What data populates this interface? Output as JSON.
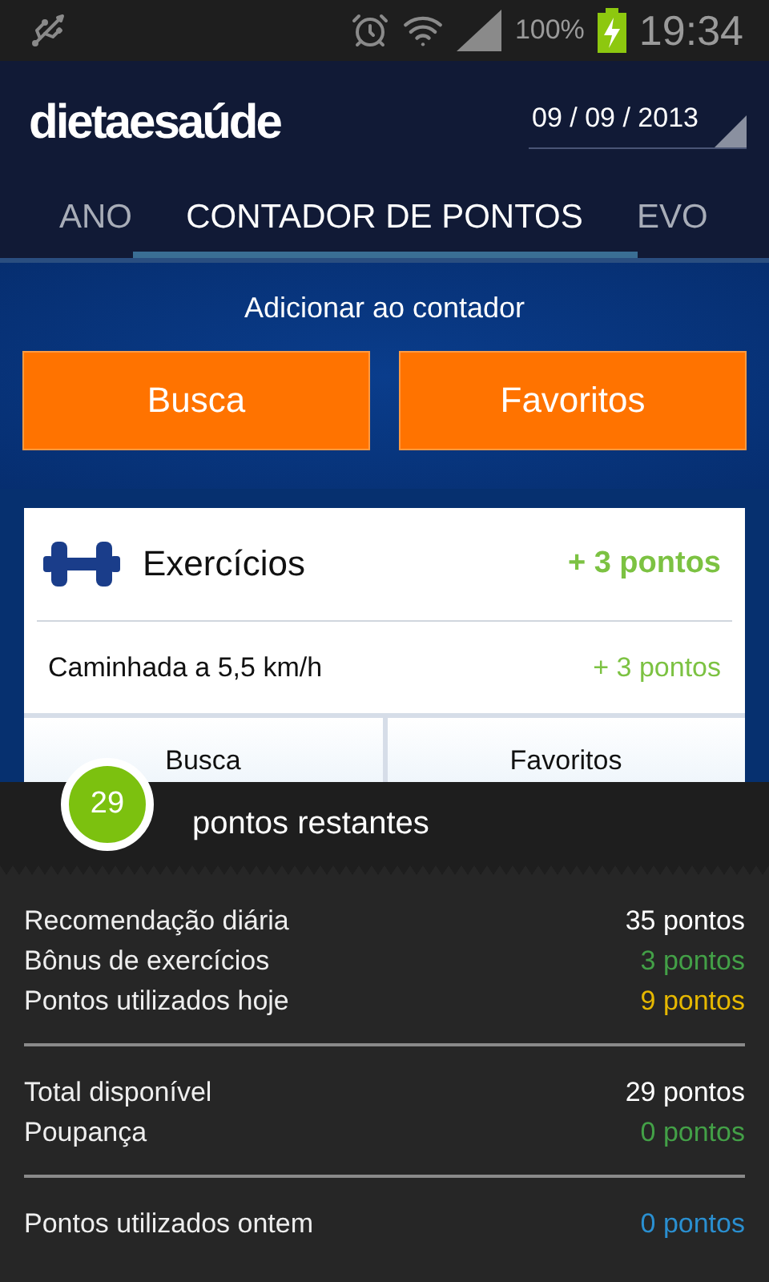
{
  "status_bar": {
    "battery": "100%",
    "time": "19:34"
  },
  "header": {
    "logo": "dietaesaúde",
    "date": "09 / 09 / 2013"
  },
  "tabs": [
    {
      "label": "ANO",
      "selected": false
    },
    {
      "label": "CONTADOR DE PONTOS",
      "selected": true
    },
    {
      "label": "EVO",
      "selected": false
    }
  ],
  "add_section": {
    "title": "Adicionar ao contador",
    "buttons": [
      "Busca",
      "Favoritos"
    ]
  },
  "exercise_card": {
    "title": "Exercícios",
    "total": "+ 3 pontos",
    "items": [
      {
        "name": "Caminhada a 5,5 km/h",
        "points": "+ 3 pontos"
      }
    ],
    "buttons": [
      "Busca",
      "Favoritos"
    ]
  },
  "summary": {
    "remaining": "29",
    "remaining_label": "pontos restantes",
    "groups": [
      [
        {
          "label": "Recomendação diária",
          "value": "35 pontos",
          "color": "#ffffff"
        },
        {
          "label": "Bônus de exercícios",
          "value": "3 pontos",
          "color": "#43a047"
        },
        {
          "label": "Pontos utilizados hoje",
          "value": "9 pontos",
          "color": "#e6b800"
        }
      ],
      [
        {
          "label": "Total disponível",
          "value": "29 pontos",
          "color": "#ffffff"
        },
        {
          "label": "Poupança",
          "value": "0 pontos",
          "color": "#43a047"
        }
      ],
      [
        {
          "label": "Pontos utilizados ontem",
          "value": "0 pontos",
          "color": "#2a8fd0"
        }
      ]
    ]
  }
}
